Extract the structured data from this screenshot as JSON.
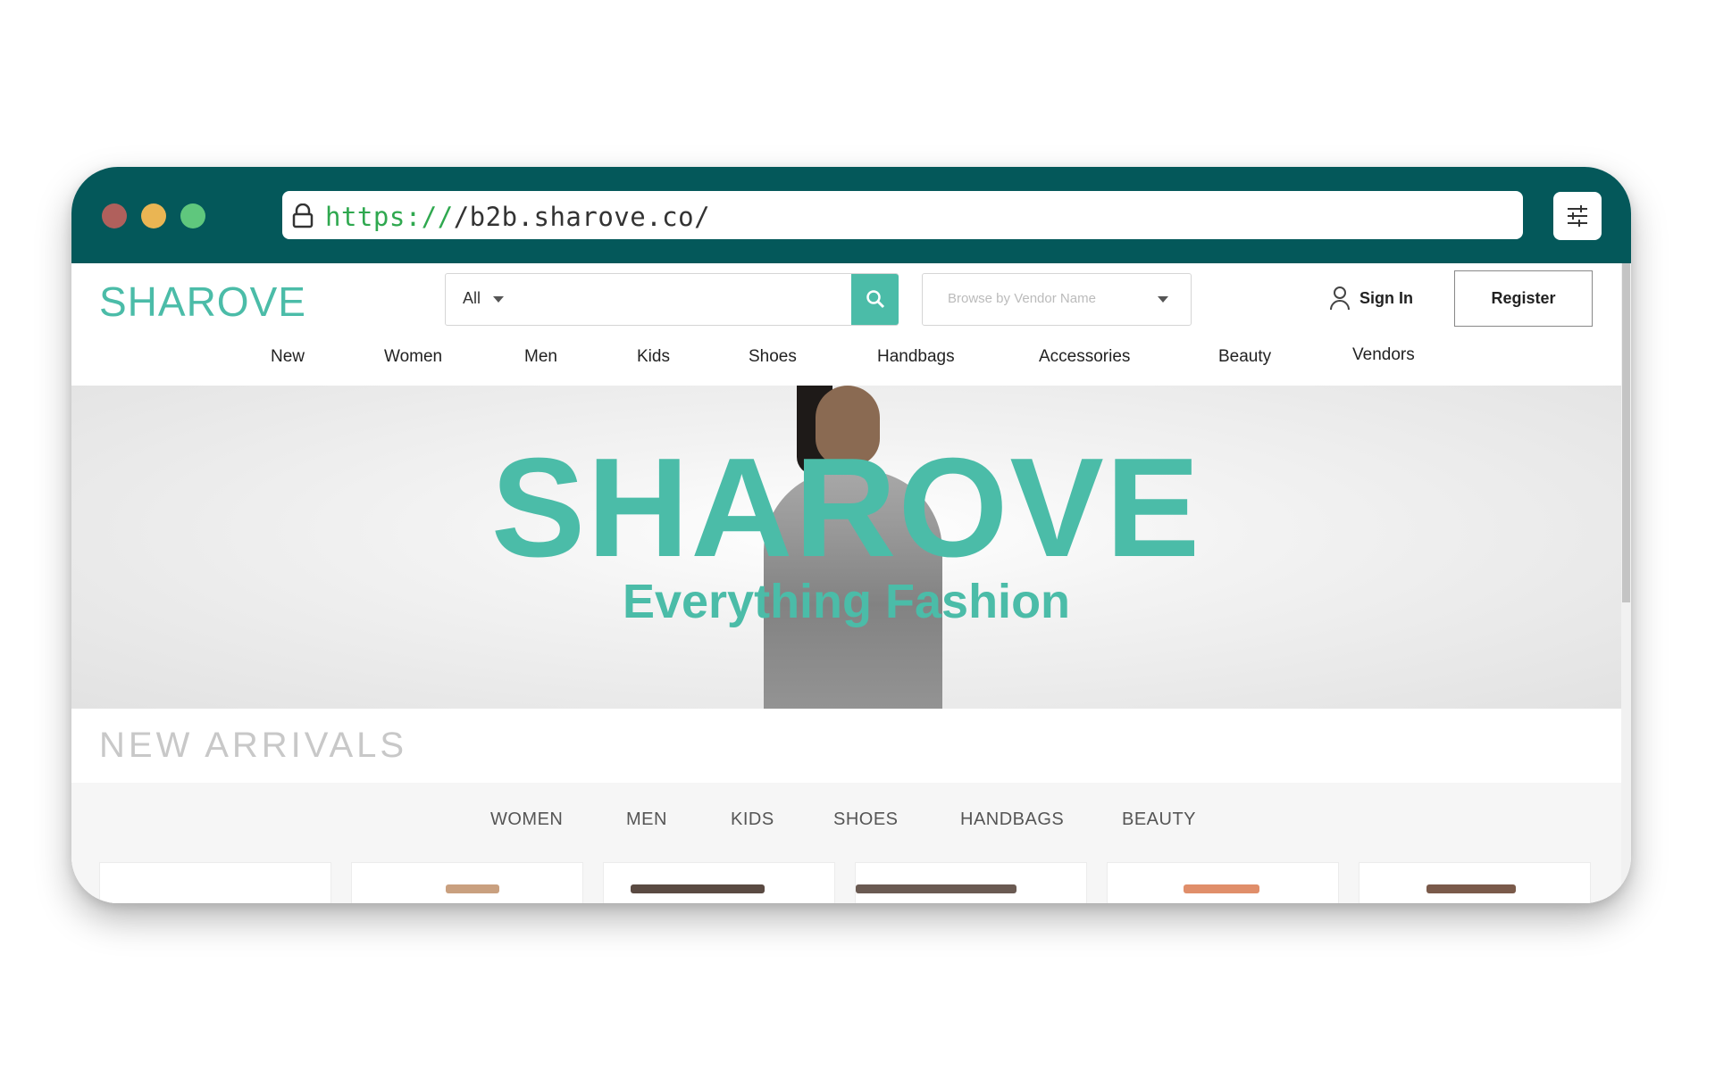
{
  "browser": {
    "url_protocol": "https://",
    "url_rest": "/b2b.sharove.co/"
  },
  "header": {
    "logo": "SHAROVE",
    "search_category": "All",
    "vendor_placeholder": "Browse by Vendor Name",
    "sign_in": "Sign In",
    "register": "Register"
  },
  "nav": [
    "New",
    "Women",
    "Men",
    "Kids",
    "Shoes",
    "Handbags",
    "Accessories",
    "Beauty",
    "Vendors"
  ],
  "hero": {
    "title": "SHAROVE",
    "subtitle": "Everything Fashion"
  },
  "new_arrivals": {
    "title": "NEW ARRIVALS",
    "tabs": [
      "WOMEN",
      "MEN",
      "KIDS",
      "SHOES",
      "HANDBAGS",
      "BEAUTY"
    ]
  },
  "colors": {
    "brand": "#4bbca8",
    "chrome": "#04585a"
  }
}
